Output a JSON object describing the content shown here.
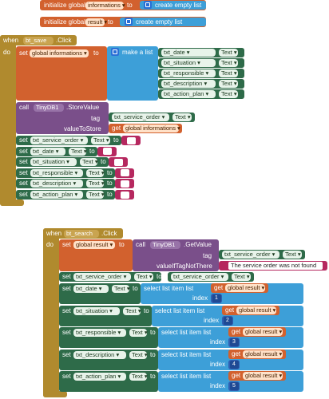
{
  "init1": {
    "prefix": "initialize global",
    "name": "informations",
    "to": "to",
    "create": "create empty list"
  },
  "init2": {
    "prefix": "initialize global",
    "name": "result",
    "to": "to",
    "create": "create empty list"
  },
  "save": {
    "when": "when",
    "component": "bt_save",
    "event": ".Click",
    "do": "do",
    "set1": "set",
    "var1": "global informations",
    "to": "to",
    "make": "make a list",
    "list_items": [
      {
        "comp": "txt_date",
        "prop": "Text"
      },
      {
        "comp": "txt_situation",
        "prop": "Text"
      },
      {
        "comp": "txt_responsible",
        "prop": "Text"
      },
      {
        "comp": "txt_description",
        "prop": "Text"
      },
      {
        "comp": "txt_action_plan",
        "prop": "Text"
      }
    ],
    "call": "call",
    "db": "TinyDB1",
    "method": ".StoreValue",
    "tag": "tag",
    "tag_comp": "txt_service_order",
    "tag_prop": "Text",
    "value": "valueToStore",
    "get": "get",
    "get_var": "global informations",
    "sets": [
      {
        "set": "set",
        "comp": "txt_service_order",
        "prop": "Text",
        "to": "to"
      },
      {
        "set": "set",
        "comp": "txt_date",
        "prop": "Text",
        "to": "to"
      },
      {
        "set": "set",
        "comp": "txt_situation",
        "prop": "Text",
        "to": "to"
      },
      {
        "set": "set",
        "comp": "txt_responsible",
        "prop": "Text",
        "to": "to"
      },
      {
        "set": "set",
        "comp": "txt_description",
        "prop": "Text",
        "to": "to"
      },
      {
        "set": "set",
        "comp": "txt_action_plan",
        "prop": "Text",
        "to": "to"
      }
    ]
  },
  "search": {
    "when": "when",
    "component": "bt_search",
    "event": ".Click",
    "do": "do",
    "set1": "set",
    "var1": "global result",
    "to": "to",
    "call": "call",
    "db": "TinyDB1",
    "method": ".GetValue",
    "tag": "tag",
    "tag_comp": "txt_service_order",
    "tag_prop": "Text",
    "ifnot": "valueIfTagNotThere",
    "not_found": "The service order was not found",
    "set_so": {
      "set": "set",
      "comp": "txt_service_order",
      "prop": "Text",
      "to": "to",
      "rcomp": "txt_service_order",
      "rprop": "Text"
    },
    "rows": [
      {
        "set": "set",
        "comp": "txt_date",
        "prop": "Text",
        "to": "to",
        "select": "select list item  list",
        "get": "get",
        "gvar": "global result",
        "index": "index",
        "n": "1"
      },
      {
        "set": "set",
        "comp": "txt_situation",
        "prop": "Text",
        "to": "to",
        "select": "select list item  list",
        "get": "get",
        "gvar": "global result",
        "index": "index",
        "n": "2"
      },
      {
        "set": "set",
        "comp": "txt_responsible",
        "prop": "Text",
        "to": "to",
        "select": "select list item  list",
        "get": "get",
        "gvar": "global result",
        "index": "index",
        "n": "3"
      },
      {
        "set": "set",
        "comp": "txt_description",
        "prop": "Text",
        "to": "to",
        "select": "select list item  list",
        "get": "get",
        "gvar": "global result",
        "index": "index",
        "n": "4"
      },
      {
        "set": "set",
        "comp": "txt_action_plan",
        "prop": "Text",
        "to": "to",
        "select": "select list item  list",
        "get": "get",
        "gvar": "global result",
        "index": "index",
        "n": "5"
      }
    ]
  },
  "colors": {
    "event": "#b08a2e",
    "var": "#d2612e",
    "list": "#3d9fd8",
    "comp": "#2e6b49",
    "db": "#7a4f8a",
    "text": "#b6285f",
    "math": "#2f5fb3"
  }
}
